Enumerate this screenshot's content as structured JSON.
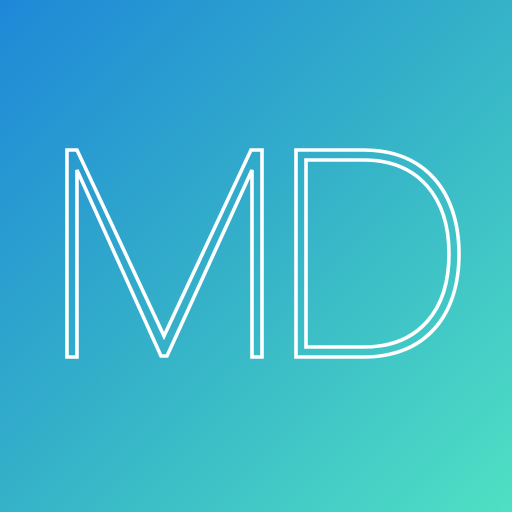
{
  "icon": {
    "monogram": "MD",
    "colors": {
      "gradient_start": "#1e88d8",
      "gradient_mid": "#35b2c8",
      "gradient_end": "#4fe0c4",
      "glyph": "#ffffff"
    }
  }
}
